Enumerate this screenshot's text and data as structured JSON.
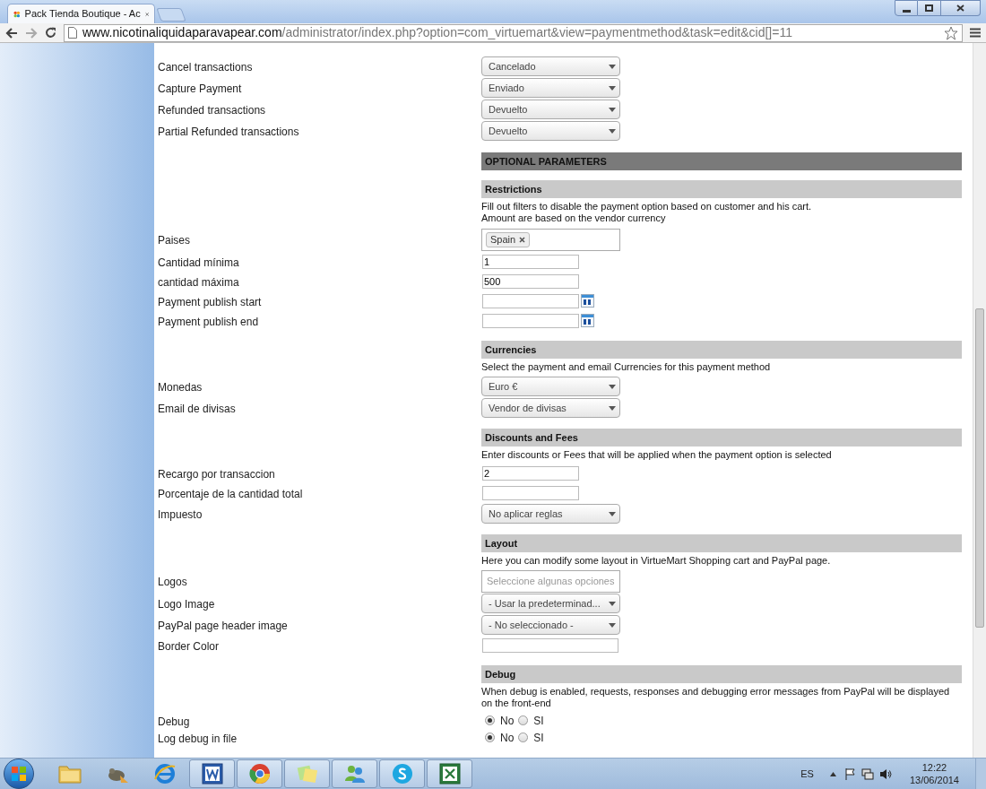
{
  "browser": {
    "tab_title": "Pack Tienda Boutique - Ac",
    "url_domain": "www.nicotinaliquidaparavapear.com",
    "url_path": "/administrator/index.php?option=com_virtuemart&view=paymentmethod&task=edit&cid[]=11"
  },
  "form": {
    "rows": [
      {
        "kind": "select",
        "label": "Cancel transactions",
        "value": "Cancelado"
      },
      {
        "kind": "select",
        "label": "Capture Payment",
        "value": "Enviado"
      },
      {
        "kind": "select",
        "label": "Refunded transactions",
        "value": "Devuelto"
      },
      {
        "kind": "select",
        "label": "Partial Refunded transactions",
        "value": "Devuelto"
      },
      {
        "kind": "title",
        "text": "OPTIONAL PARAMETERS"
      },
      {
        "kind": "section",
        "text": "Restrictions"
      },
      {
        "kind": "note",
        "text": "Fill out filters to disable the payment option based on customer and his cart.\nAmount are based on the vendor currency"
      },
      {
        "kind": "tags",
        "label": "Paises",
        "tags": [
          "Spain"
        ]
      },
      {
        "kind": "input",
        "label": "Cantidad mínima",
        "value": "1"
      },
      {
        "kind": "input",
        "label": "cantidad máxima",
        "value": "500"
      },
      {
        "kind": "date",
        "label": "Payment publish start"
      },
      {
        "kind": "date",
        "label": "Payment publish end"
      },
      {
        "kind": "section",
        "text": "Currencies"
      },
      {
        "kind": "note",
        "text": "Select the payment and email Currencies for this payment method"
      },
      {
        "kind": "select",
        "label": "Monedas",
        "value": "Euro €"
      },
      {
        "kind": "select",
        "label": "Email de divisas",
        "value": "Vendor de divisas"
      },
      {
        "kind": "section",
        "text": "Discounts and Fees"
      },
      {
        "kind": "note",
        "text": "Enter discounts or Fees that will be applied when the payment option is selected"
      },
      {
        "kind": "input",
        "label": "Recargo por transaccion",
        "value": "2"
      },
      {
        "kind": "input",
        "label": "Porcentaje de la cantidad total"
      },
      {
        "kind": "select",
        "label": "Impuesto",
        "value": "No aplicar reglas"
      },
      {
        "kind": "section",
        "text": "Layout"
      },
      {
        "kind": "note",
        "text": "Here you can modify some layout in VirtueMart Shopping cart and PayPal page."
      },
      {
        "kind": "multiselect",
        "label": "Logos",
        "placeholder": "Seleccione algunas opciones"
      },
      {
        "kind": "select",
        "label": "Logo Image",
        "value": "- Usar la predeterminad..."
      },
      {
        "kind": "select",
        "label": "PayPal page header image",
        "value": "- No seleccionado -"
      },
      {
        "kind": "wide_input",
        "label": "Border Color"
      },
      {
        "kind": "section",
        "text": "Debug"
      },
      {
        "kind": "note",
        "text": "When debug is enabled, requests, responses and debugging error messages from PayPal will be displayed on the front-end"
      },
      {
        "kind": "radio",
        "label": "Debug",
        "options": [
          {
            "label": "No",
            "selected": true
          },
          {
            "label": "SI",
            "selected": false
          }
        ]
      },
      {
        "kind": "radio",
        "label": "Log debug in file",
        "options": [
          {
            "label": "No",
            "selected": true
          },
          {
            "label": "SI",
            "selected": false
          }
        ]
      }
    ]
  },
  "taskbar": {
    "apps": [
      {
        "kind": "folder",
        "open": false
      },
      {
        "kind": "gimp",
        "open": false
      },
      {
        "kind": "ie",
        "open": false
      },
      {
        "kind": "word",
        "open": true
      },
      {
        "kind": "chrome",
        "open": true
      },
      {
        "kind": "notes",
        "open": true
      },
      {
        "kind": "people",
        "open": true
      },
      {
        "kind": "skype",
        "open": true
      },
      {
        "kind": "excel",
        "open": true
      }
    ]
  },
  "tray": {
    "language": "ES",
    "time": "12:22",
    "date": "13/06/2014"
  }
}
